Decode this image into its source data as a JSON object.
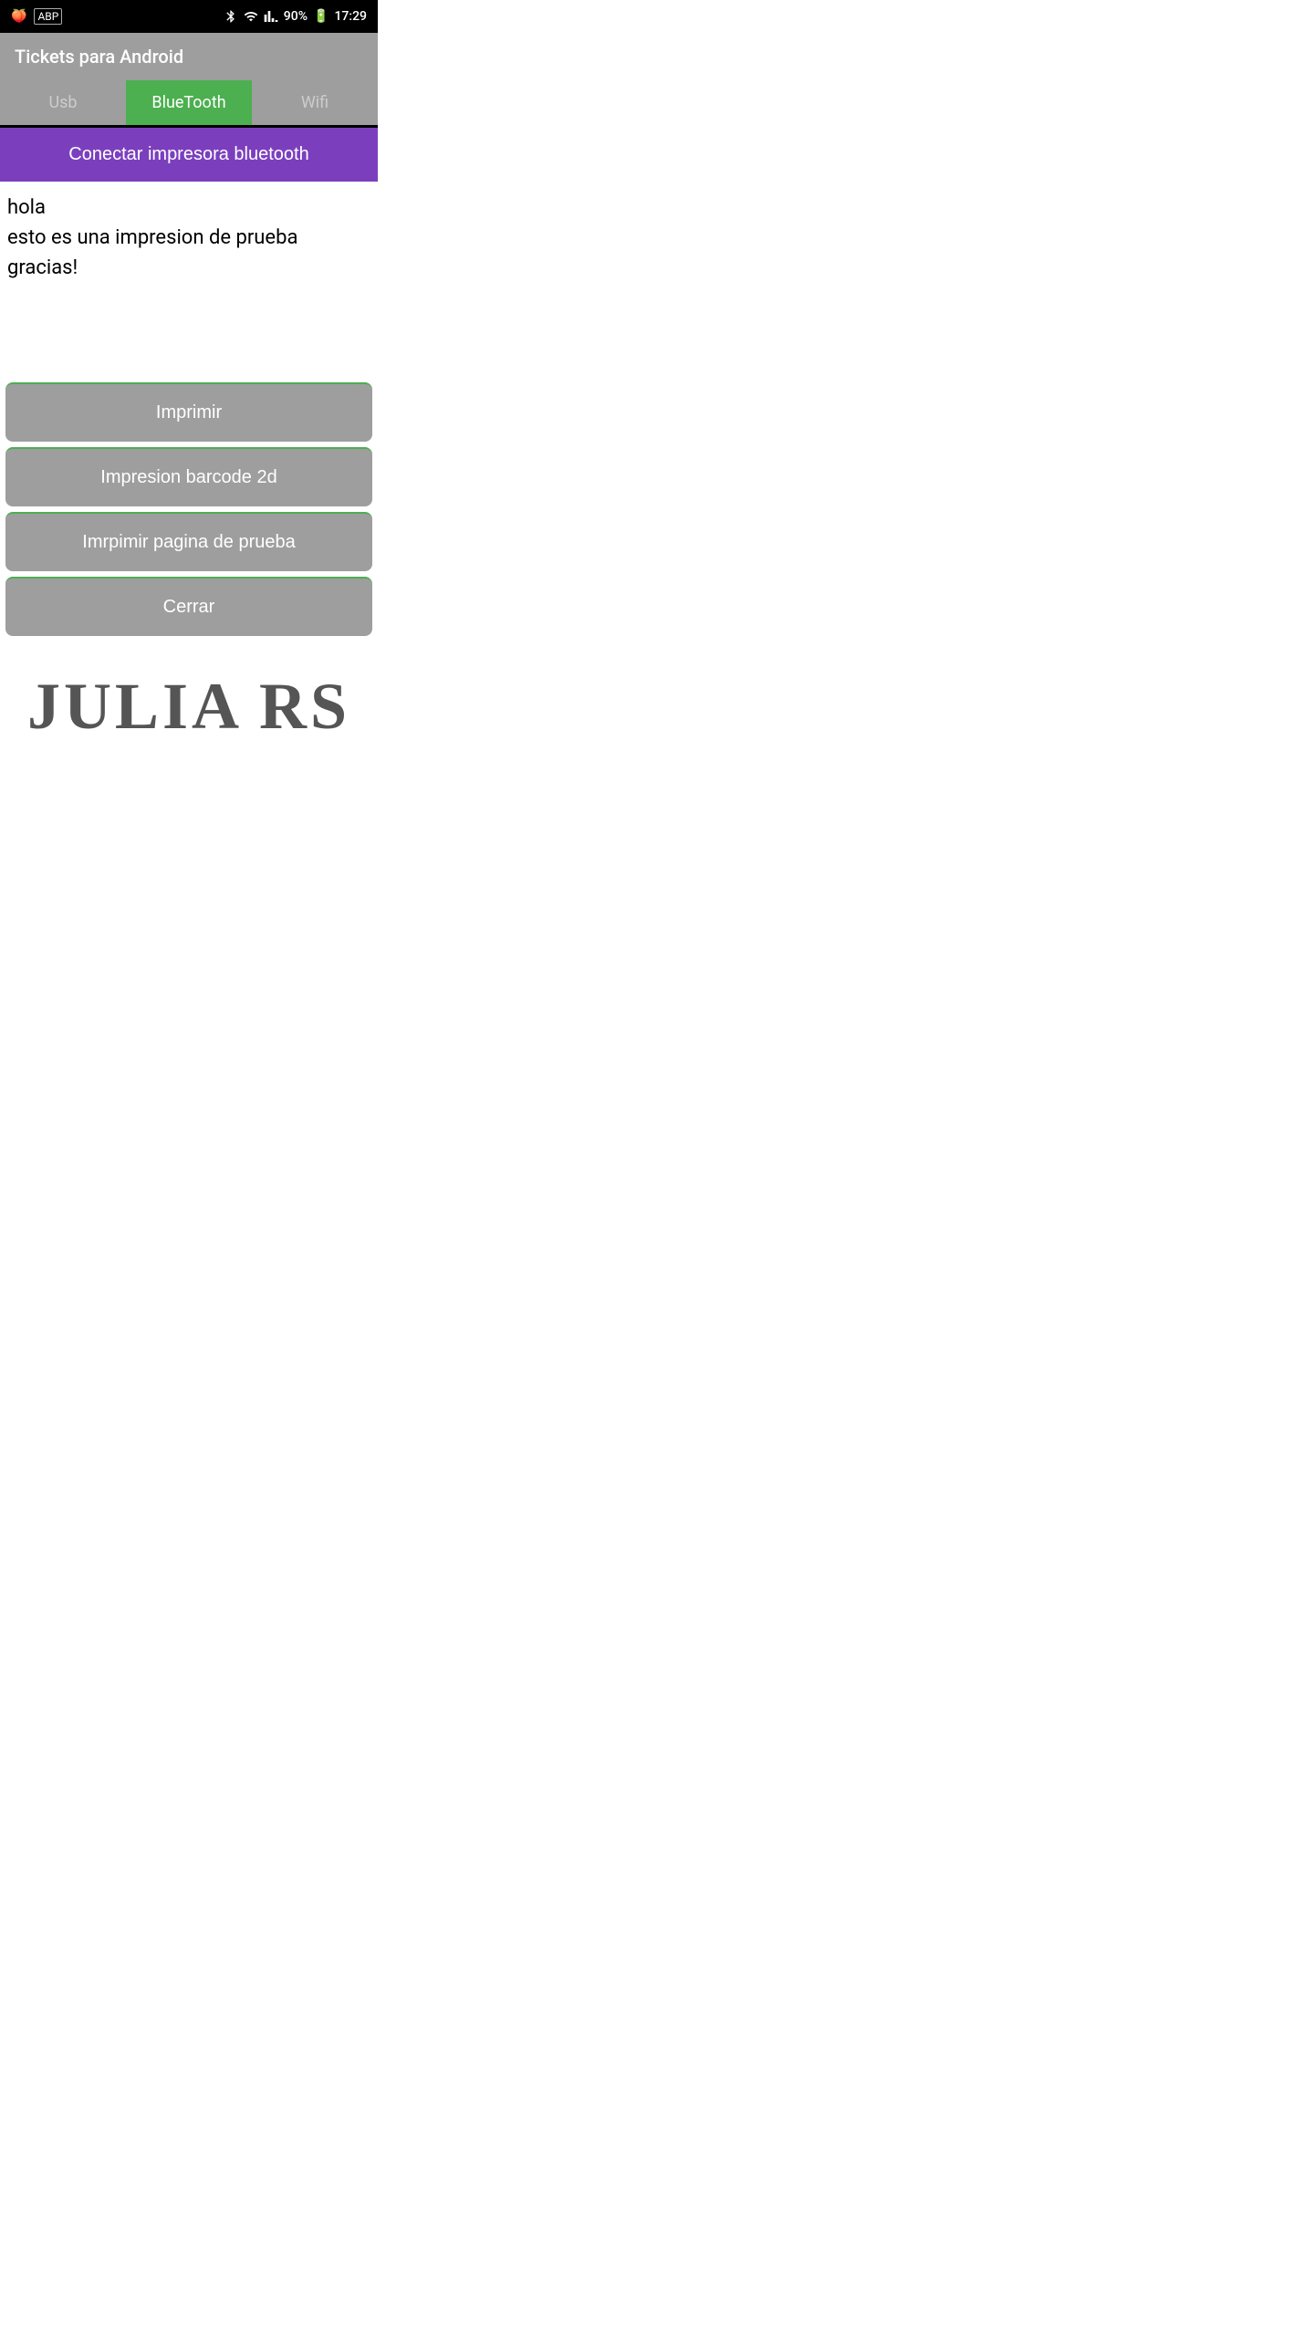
{
  "statusBar": {
    "leftIcons": [
      "fruit-icon",
      "adblock-icon"
    ],
    "bluetooth": "✱",
    "wifi": "WiFi",
    "signal": "▲",
    "battery": "90%",
    "time": "17:29"
  },
  "appBar": {
    "title": "Tickets para Android"
  },
  "tabs": [
    {
      "id": "usb",
      "label": "Usb",
      "active": false
    },
    {
      "id": "bluetooth",
      "label": "BlueTooth",
      "active": true
    },
    {
      "id": "wifi",
      "label": "Wifi",
      "active": false
    }
  ],
  "connectButton": {
    "label": "Conectar impresora bluetooth"
  },
  "textContent": {
    "line1": "hola",
    "line2": "esto es una impresion de prueba",
    "line3": "gracias!"
  },
  "buttons": [
    {
      "id": "imprimir",
      "label": "Imprimir"
    },
    {
      "id": "barcode",
      "label": "Impresion barcode 2d"
    },
    {
      "id": "pagina-prueba",
      "label": "Imrpimir pagina de prueba"
    },
    {
      "id": "cerrar",
      "label": "Cerrar"
    }
  ],
  "logo": {
    "text": "JULIA RS"
  },
  "colors": {
    "tabActive": "#4caf50",
    "tabInactive": "#9e9e9e",
    "connectBg": "#7b3fbe",
    "buttonBg": "#9e9e9e",
    "buttonBorder": "#4caf50"
  }
}
